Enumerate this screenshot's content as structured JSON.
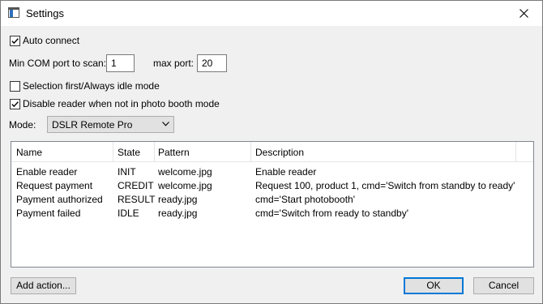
{
  "window": {
    "title": "Settings"
  },
  "options": {
    "auto_connect": {
      "label": "Auto connect",
      "checked": true
    },
    "min_com_label": "Min COM port to scan:",
    "min_com_value": "1",
    "max_port_label": "max port:",
    "max_port_value": "20",
    "selection_first": {
      "label": "Selection first/Always idle mode",
      "checked": false
    },
    "disable_reader": {
      "label": "Disable reader when not in photo booth mode",
      "checked": true
    },
    "mode_label": "Mode:",
    "mode_value": "DSLR Remote Pro"
  },
  "table": {
    "columns": [
      "Name",
      "State",
      "Pattern",
      "Description"
    ],
    "rows": [
      [
        "Enable reader",
        "INIT",
        "welcome.jpg",
        "Enable reader"
      ],
      [
        "Request payment",
        "CREDIT",
        "welcome.jpg",
        "Request 100, product 1, cmd='Switch from standby to ready'"
      ],
      [
        "Payment authorized",
        "RESULT",
        "ready.jpg",
        "cmd='Start photobooth'"
      ],
      [
        "Payment failed",
        "IDLE",
        "ready.jpg",
        "cmd='Switch from ready to standby'"
      ]
    ]
  },
  "buttons": {
    "add_action": "Add action...",
    "ok": "OK",
    "cancel": "Cancel"
  }
}
